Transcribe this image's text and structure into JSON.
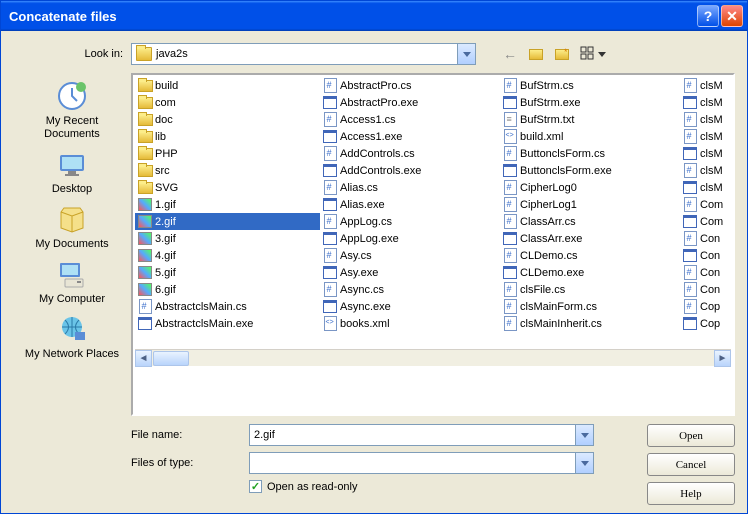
{
  "title": "Concatenate files",
  "lookin": {
    "label": "Look in:",
    "value": "java2s"
  },
  "places": [
    {
      "name": "recent",
      "label": "My Recent Documents"
    },
    {
      "name": "desktop",
      "label": "Desktop"
    },
    {
      "name": "mydocs",
      "label": "My Documents"
    },
    {
      "name": "mycomputer",
      "label": "My Computer"
    },
    {
      "name": "network",
      "label": "My Network Places"
    }
  ],
  "columns": [
    [
      {
        "name": "build",
        "type": "folder"
      },
      {
        "name": "com",
        "type": "folder"
      },
      {
        "name": "doc",
        "type": "folder"
      },
      {
        "name": "lib",
        "type": "folder"
      },
      {
        "name": "PHP",
        "type": "folder"
      },
      {
        "name": "src",
        "type": "folder"
      },
      {
        "name": "SVG",
        "type": "folder"
      },
      {
        "name": "1.gif",
        "type": "gif"
      },
      {
        "name": "2.gif",
        "type": "gif",
        "selected": true
      },
      {
        "name": "3.gif",
        "type": "gif"
      },
      {
        "name": "4.gif",
        "type": "gif"
      },
      {
        "name": "5.gif",
        "type": "gif"
      },
      {
        "name": "6.gif",
        "type": "gif"
      },
      {
        "name": "AbstractclsMain.cs",
        "type": "cs"
      },
      {
        "name": "AbstractclsMain.exe",
        "type": "exe"
      }
    ],
    [
      {
        "name": "AbstractPro.cs",
        "type": "cs"
      },
      {
        "name": "AbstractPro.exe",
        "type": "exe"
      },
      {
        "name": "Access1.cs",
        "type": "cs"
      },
      {
        "name": "Access1.exe",
        "type": "exe"
      },
      {
        "name": "AddControls.cs",
        "type": "cs"
      },
      {
        "name": "AddControls.exe",
        "type": "exe"
      },
      {
        "name": "Alias.cs",
        "type": "cs"
      },
      {
        "name": "Alias.exe",
        "type": "exe"
      },
      {
        "name": "AppLog.cs",
        "type": "cs"
      },
      {
        "name": "AppLog.exe",
        "type": "exe"
      },
      {
        "name": "Asy.cs",
        "type": "cs"
      },
      {
        "name": "Asy.exe",
        "type": "exe"
      },
      {
        "name": "Async.cs",
        "type": "cs"
      },
      {
        "name": "Async.exe",
        "type": "exe"
      },
      {
        "name": "books.xml",
        "type": "xml"
      }
    ],
    [
      {
        "name": "BufStrm.cs",
        "type": "cs"
      },
      {
        "name": "BufStrm.exe",
        "type": "exe"
      },
      {
        "name": "BufStrm.txt",
        "type": "txt"
      },
      {
        "name": "build.xml",
        "type": "xml"
      },
      {
        "name": "ButtonclsForm.cs",
        "type": "cs"
      },
      {
        "name": "ButtonclsForm.exe",
        "type": "exe"
      },
      {
        "name": "CipherLog0",
        "type": "cs"
      },
      {
        "name": "CipherLog1",
        "type": "cs"
      },
      {
        "name": "ClassArr.cs",
        "type": "cs"
      },
      {
        "name": "ClassArr.exe",
        "type": "exe"
      },
      {
        "name": "CLDemo.cs",
        "type": "cs"
      },
      {
        "name": "CLDemo.exe",
        "type": "exe"
      },
      {
        "name": "clsFile.cs",
        "type": "cs"
      },
      {
        "name": "clsMainForm.cs",
        "type": "cs"
      },
      {
        "name": "clsMainInherit.cs",
        "type": "cs"
      }
    ],
    [
      {
        "name": "clsM",
        "type": "cs"
      },
      {
        "name": "clsM",
        "type": "exe"
      },
      {
        "name": "clsM",
        "type": "cs"
      },
      {
        "name": "clsM",
        "type": "cs"
      },
      {
        "name": "clsM",
        "type": "exe"
      },
      {
        "name": "clsM",
        "type": "cs"
      },
      {
        "name": "clsM",
        "type": "exe"
      },
      {
        "name": "Com",
        "type": "cs"
      },
      {
        "name": "Com",
        "type": "exe"
      },
      {
        "name": "Con",
        "type": "cs"
      },
      {
        "name": "Con",
        "type": "exe"
      },
      {
        "name": "Con",
        "type": "cs"
      },
      {
        "name": "Con",
        "type": "cs"
      },
      {
        "name": "Cop",
        "type": "cs"
      },
      {
        "name": "Cop",
        "type": "exe"
      }
    ]
  ],
  "filename": {
    "label": "File name:",
    "value": "2.gif"
  },
  "filetype": {
    "label": "Files of type:",
    "value": ""
  },
  "readonly": {
    "label": "Open as read-only",
    "checked": true
  },
  "buttons": {
    "open": "Open",
    "cancel": "Cancel",
    "help": "Help"
  }
}
